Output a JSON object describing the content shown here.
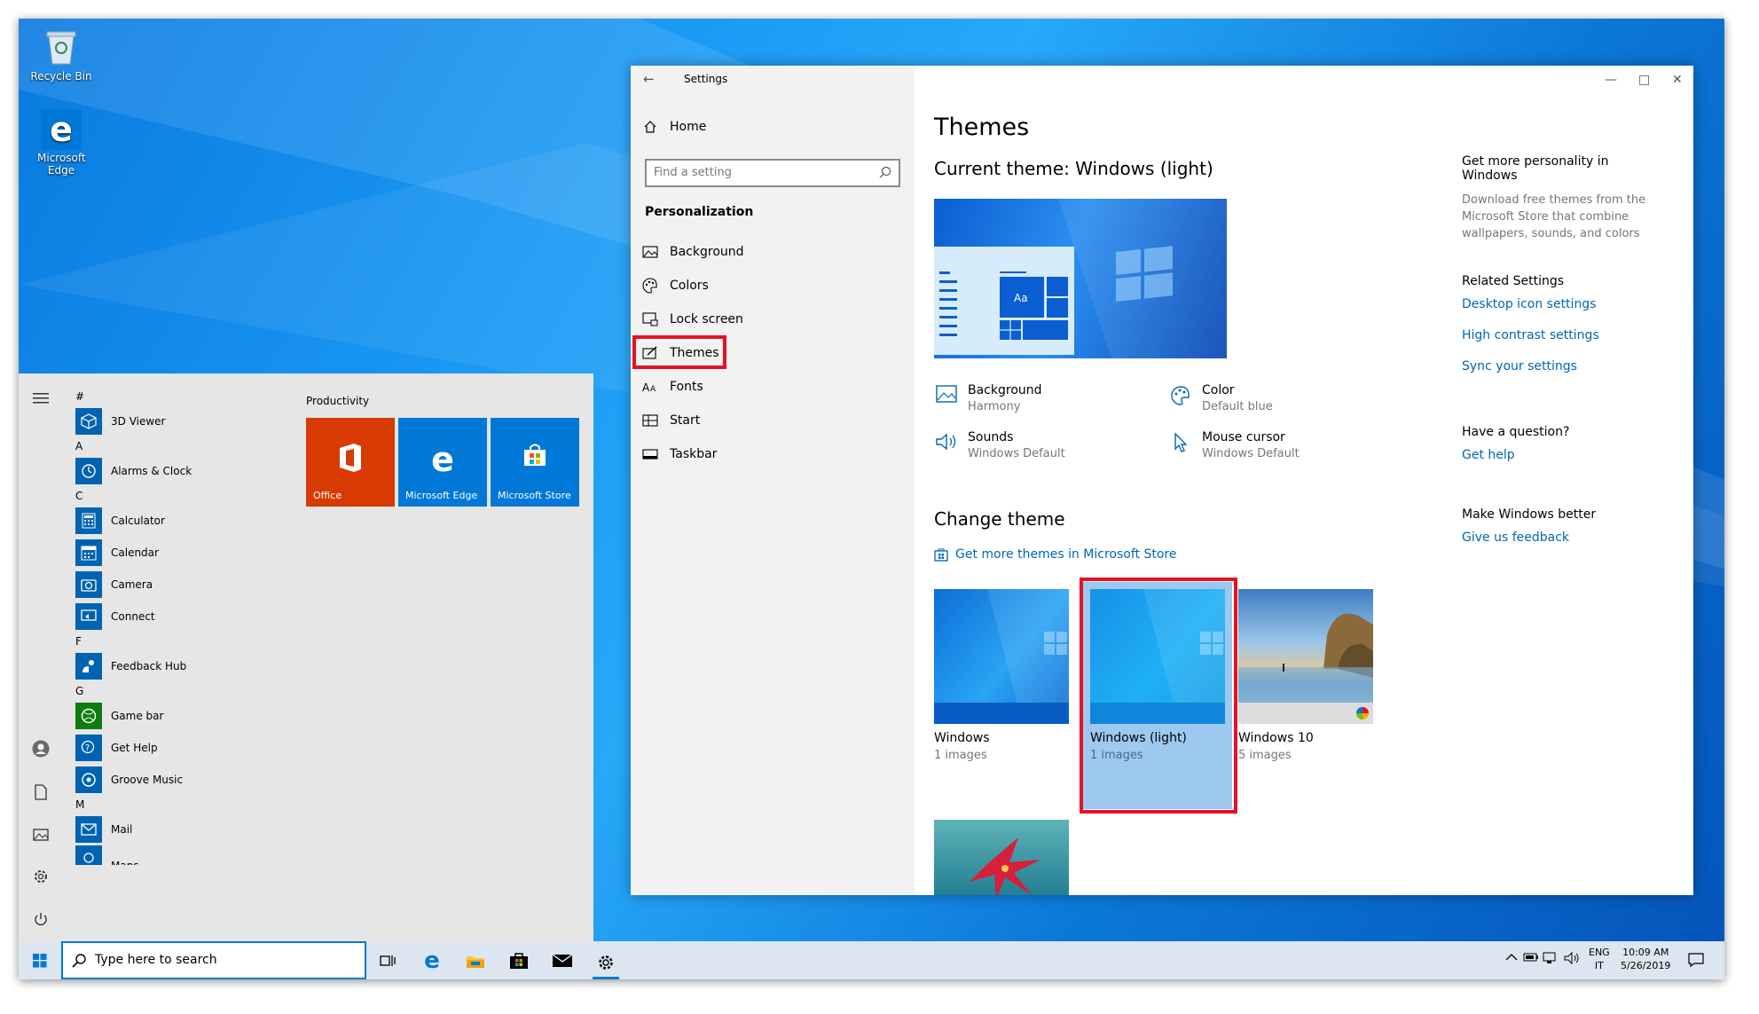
{
  "desktop": {
    "icons": [
      {
        "label": "Recycle Bin"
      },
      {
        "label": "Microsoft Edge"
      }
    ]
  },
  "start_menu": {
    "group_title": "Productivity",
    "letters": [
      "#",
      "A",
      "C",
      "F",
      "G",
      "M"
    ],
    "apps": {
      "hash": [
        "3D Viewer"
      ],
      "a": [
        "Alarms & Clock"
      ],
      "c": [
        "Calculator",
        "Calendar",
        "Camera",
        "Connect"
      ],
      "f": [
        "Feedback Hub"
      ],
      "g": [
        "Game bar",
        "Get Help",
        "Groove Music"
      ],
      "m": [
        "Mail",
        "Maps"
      ]
    },
    "tiles": [
      {
        "label": "Office",
        "color": "#d83b01"
      },
      {
        "label": "Microsoft Edge",
        "color": "#0078d7"
      },
      {
        "label": "Microsoft Store",
        "color": "#0078d7"
      }
    ]
  },
  "settings": {
    "window_title": "Settings",
    "home": "Home",
    "search_placeholder": "Find a setting",
    "section": "Personalization",
    "nav": [
      "Background",
      "Colors",
      "Lock screen",
      "Themes",
      "Fonts",
      "Start",
      "Taskbar"
    ],
    "selected_nav": "Themes",
    "page_title": "Themes",
    "current_theme": "Current theme: Windows (light)",
    "preview_tile_text": "Aa",
    "properties": [
      {
        "title": "Background",
        "value": "Harmony"
      },
      {
        "title": "Color",
        "value": "Default blue"
      },
      {
        "title": "Sounds",
        "value": "Windows Default"
      },
      {
        "title": "Mouse cursor",
        "value": "Windows Default"
      }
    ],
    "change_theme": "Change theme",
    "store_link": "Get more themes in Microsoft Store",
    "themes": [
      {
        "name": "Windows",
        "count": "1 images"
      },
      {
        "name": "Windows (light)",
        "count": "1 images",
        "selected": true
      },
      {
        "name": "Windows 10",
        "count": "5 images"
      }
    ],
    "side": {
      "personality_title": "Get more personality in Windows",
      "personality_text": "Download free themes from the Microsoft Store that combine wallpapers, sounds, and colors",
      "related_title": "Related Settings",
      "related_links": [
        "Desktop icon settings",
        "High contrast settings",
        "Sync your settings"
      ],
      "question_title": "Have a question?",
      "get_help": "Get help",
      "better_title": "Make Windows better",
      "feedback": "Give us feedback"
    },
    "accent_color": "#0066b4",
    "highlight_color": "#e81123"
  },
  "taskbar": {
    "search_placeholder": "Type here to search",
    "lang": "ENG",
    "lang_sub": "IT",
    "time": "10:09 AM",
    "date": "5/26/2019"
  }
}
